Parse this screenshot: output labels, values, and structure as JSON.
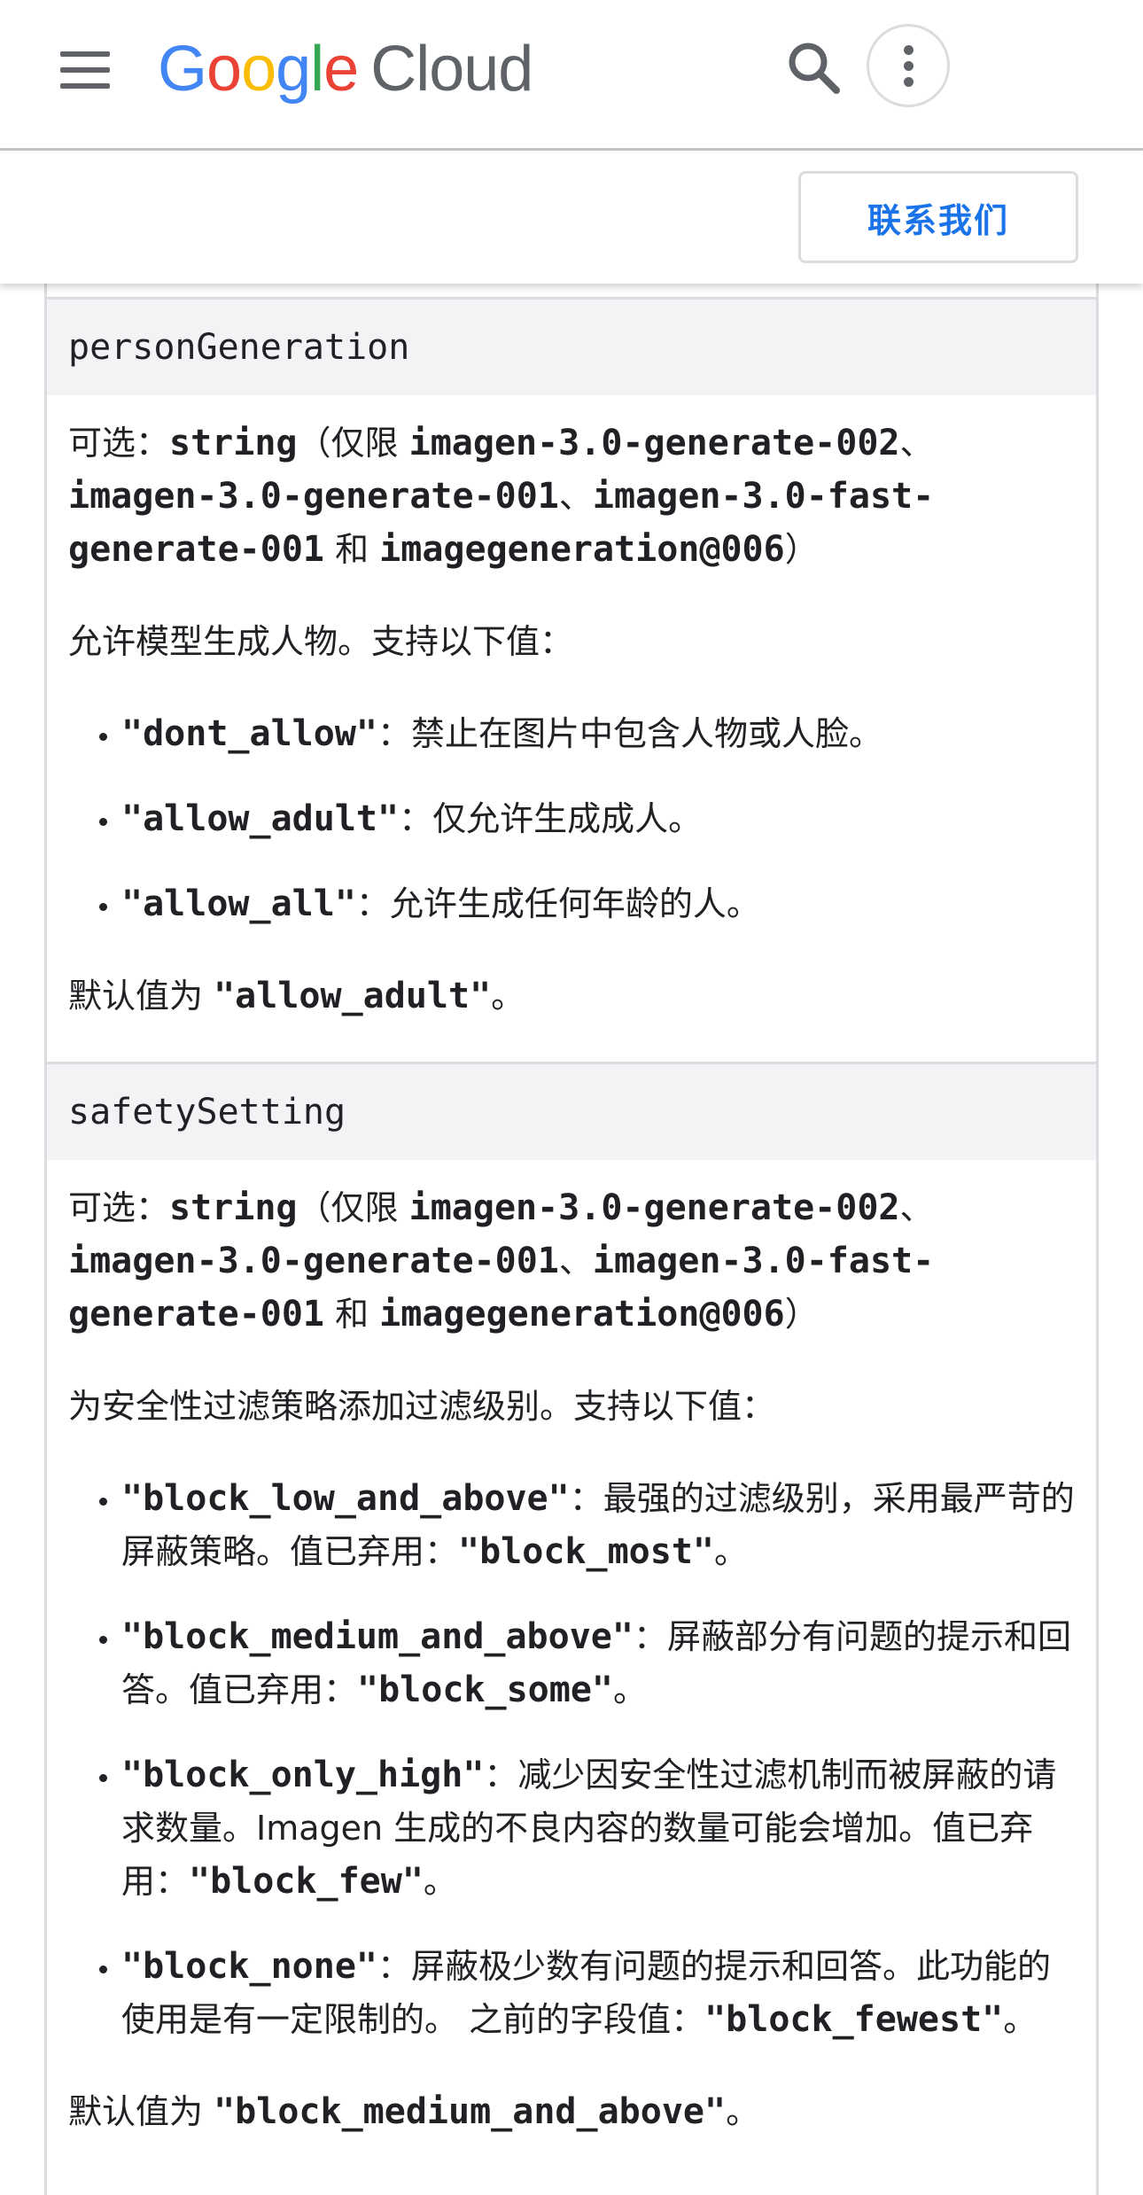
{
  "header": {
    "logo_google": "Google",
    "logo_cloud": "Cloud",
    "icons": [
      "menu-icon",
      "search-icon",
      "more-vert-icon"
    ]
  },
  "subbar": {
    "contact_label": "联系我们"
  },
  "person_generation": {
    "name": "personGeneration",
    "type_prefix": "可选：",
    "type": "string",
    "restrict_open": "（仅限 ",
    "m1": "imagen-3.0-generate-002",
    "sep1": "、",
    "m2": "imagen-3.0-generate-001",
    "sep2": "、",
    "m3": "imagen-3.0-fast-generate-001",
    "and": " 和 ",
    "m4": "imagegeneration@006",
    "restrict_close": "）",
    "desc": "允许模型生成人物。支持以下值：",
    "values": [
      {
        "code": "\"dont_allow\"",
        "text": "：禁止在图片中包含人物或人脸。"
      },
      {
        "code": "\"allow_adult\"",
        "text": "：仅允许生成成人。"
      },
      {
        "code": "\"allow_all\"",
        "text": "：允许生成任何年龄的人。"
      }
    ],
    "default_prefix": "默认值为 ",
    "default_code": "\"allow_adult\"",
    "default_suffix": "。"
  },
  "safety_setting": {
    "name": "safetySetting",
    "type_prefix": "可选：",
    "type": "string",
    "restrict_open": "（仅限 ",
    "m1": "imagen-3.0-generate-002",
    "sep1": "、",
    "m2": "imagen-3.0-generate-001",
    "sep2": "、",
    "m3": "imagen-3.0-fast-generate-001",
    "and": " 和 ",
    "m4": "imagegeneration@006",
    "restrict_close": "）",
    "desc": "为安全性过滤策略添加过滤级别。支持以下值：",
    "values": [
      {
        "code": "\"block_low_and_above\"",
        "text": "：最强的过滤级别，采用最严苛的屏蔽策略。值已弃用：",
        "dep_code": "\"block_most\"",
        "end": "。"
      },
      {
        "code": "\"block_medium_and_above\"",
        "text": "：屏蔽部分有问题的提示和回答。值已弃用：",
        "dep_code": "\"block_some\"",
        "end": "。"
      },
      {
        "code": "\"block_only_high\"",
        "text": "：减少因安全性过滤机制而被屏蔽的请求数量。Imagen 生成的不良内容的数量可能会增加。值已弃用：",
        "dep_code": "\"block_few\"",
        "end": "。"
      },
      {
        "code": "\"block_none\"",
        "text": "：屏蔽极少数有问题的提示和回答。此功能的使用是有一定限制的。 之前的字段值：",
        "dep_code": "\"block_fewest\"",
        "end": "。"
      }
    ],
    "default_prefix": "默认值为 ",
    "default_code": "\"block_medium_and_above\"",
    "default_suffix": "。"
  }
}
